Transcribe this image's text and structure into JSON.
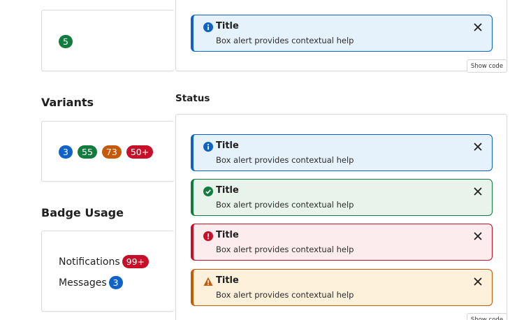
{
  "colors": {
    "info": "#0f62c8",
    "success": "#127b3e",
    "danger": "#c80f2a",
    "warning": "#c65a0a"
  },
  "top_badge": {
    "value": "5"
  },
  "variants": {
    "heading": "Variants",
    "badges": [
      "3",
      "55",
      "73",
      "50+"
    ]
  },
  "badge_usage": {
    "heading": "Badge Usage",
    "items": [
      {
        "label": "Notifications",
        "badge": "99+"
      },
      {
        "label": "Messages",
        "badge": "3"
      }
    ]
  },
  "top_alert": {
    "icon": "info-icon",
    "title": "Title",
    "body": "Box alert provides contextual help"
  },
  "show_code_label": "Show code",
  "status": {
    "heading": "Status",
    "alerts": [
      {
        "kind": "info",
        "icon": "info-icon",
        "title": "Title",
        "body": "Box alert provides contextual help"
      },
      {
        "kind": "success",
        "icon": "check-circle-icon",
        "title": "Title",
        "body": "Box alert provides contextual help"
      },
      {
        "kind": "danger",
        "icon": "error-icon",
        "title": "Title",
        "body": "Box alert provides contextual help"
      },
      {
        "kind": "warning",
        "icon": "warning-icon",
        "title": "Title",
        "body": "Box alert provides contextual help"
      }
    ]
  }
}
